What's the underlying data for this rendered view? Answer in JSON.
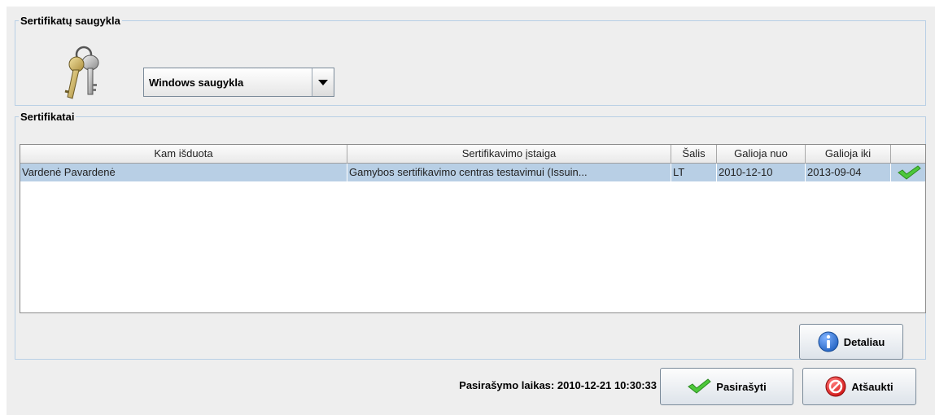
{
  "store_group": {
    "legend": "Sertifikatų saugykla",
    "selected_store": "Windows saugykla"
  },
  "cert_group": {
    "legend": "Sertifikatai",
    "columns": [
      "Kam išduota",
      "Sertifikavimo įstaiga",
      "Šalis",
      "Galioja nuo",
      "Galioja iki",
      ""
    ],
    "rows": [
      {
        "subject": "Vardenė Pavardenė",
        "issuer": "Gamybos sertifikavimo centras testavimui (Issuin...",
        "country": "LT",
        "valid_from": "2010-12-10",
        "valid_to": "2013-09-04",
        "status_icon": "green-check-icon"
      }
    ],
    "selected_row_color": "#b8cfe5",
    "detail_button": "Detaliau"
  },
  "footer": {
    "sign_time": "Pasirašymo laikas: 2010-12-21 10:30:33",
    "sign_button": "Pasirašyti",
    "cancel_button": "Atšaukti"
  },
  "colors": {
    "group_border": "#b8cfe5",
    "check_green": "#4cc83a",
    "info_blue": "#1f5fbf",
    "cancel_red": "#e02020"
  }
}
